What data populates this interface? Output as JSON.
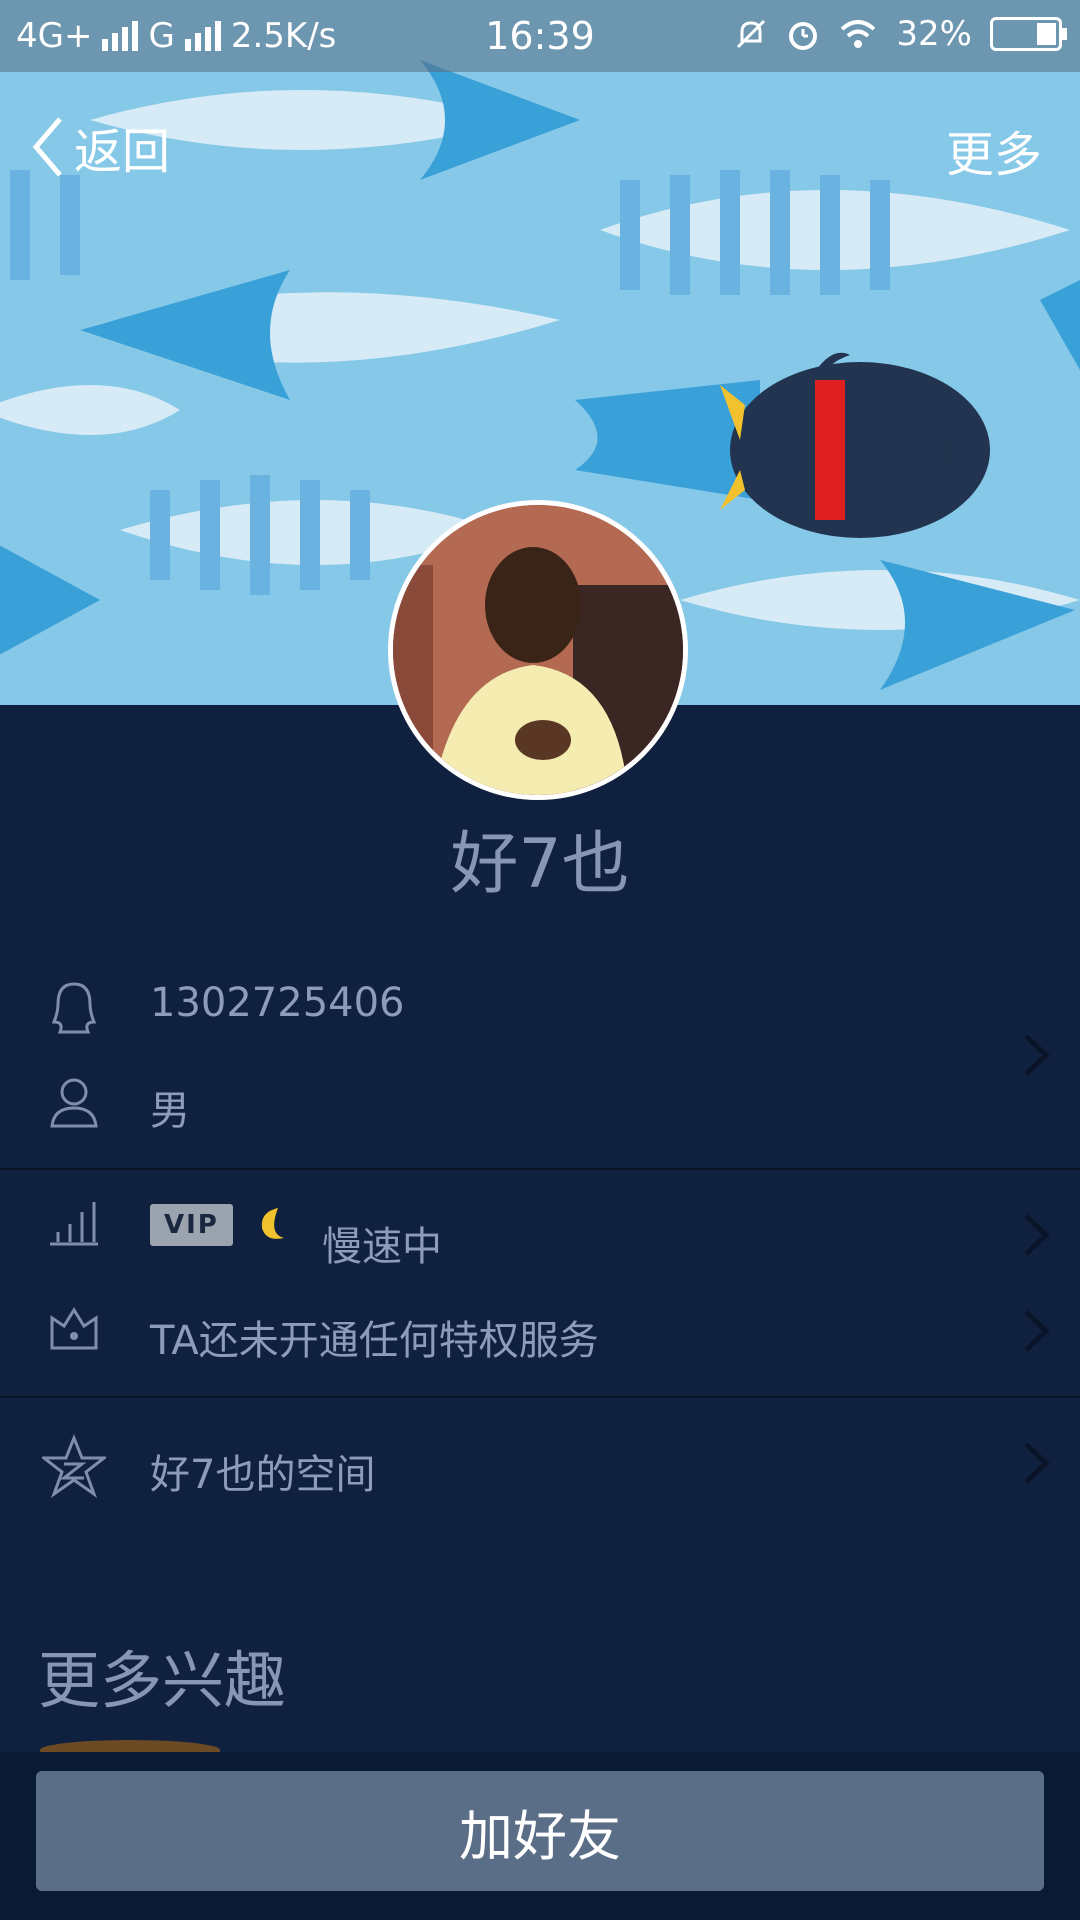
{
  "status_bar": {
    "network_1": "4G+",
    "network_2": "G",
    "speed": "2.5K/s",
    "time": "16:39",
    "battery": "32%",
    "battery_level": 0.32
  },
  "nav": {
    "back_label": "返回",
    "more_label": "更多"
  },
  "profile": {
    "nickname": "好7也",
    "qq_number": "1302725406",
    "gender": "男",
    "vip_badge": "VIP",
    "level_status": "慢速中",
    "privilege_text": "TA还未开通任何特权服务",
    "space_label": "好7也的空间"
  },
  "section": {
    "more_interests": "更多兴趣"
  },
  "actions": {
    "add_friend": "加好友"
  },
  "colors": {
    "background": "#10213f",
    "banner": "#7ec4e6",
    "button": "#5a6e87"
  }
}
